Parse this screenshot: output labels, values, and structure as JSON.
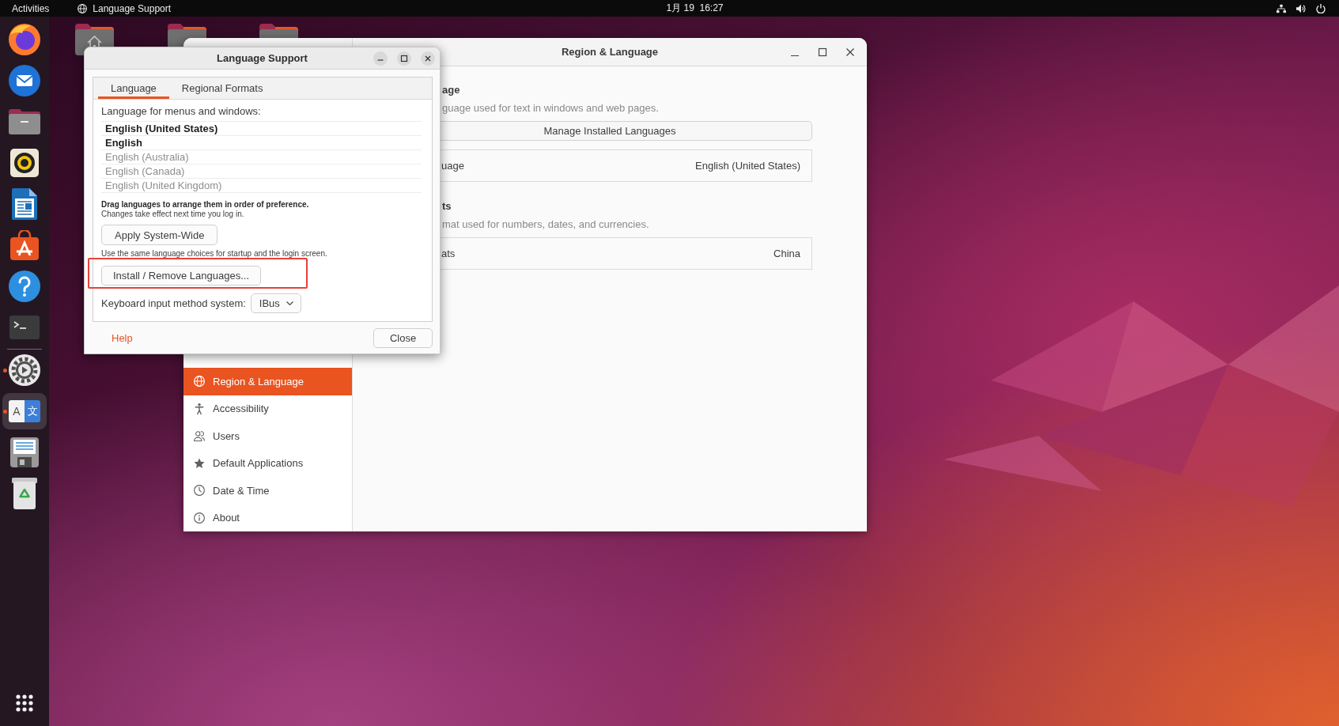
{
  "top_bar": {
    "activities": "Activities",
    "app_menu": "Language Support",
    "clock": "1月 19  16:27"
  },
  "dock": {
    "sections": [
      {
        "items": [
          {
            "kind": "browser",
            "running": false,
            "selected": false
          },
          {
            "kind": "mail",
            "running": false,
            "selected": false
          },
          {
            "kind": "files",
            "running": false,
            "selected": false
          },
          {
            "kind": "music",
            "running": false,
            "selected": false
          },
          {
            "kind": "writer",
            "running": false,
            "selected": false
          },
          {
            "kind": "store",
            "running": false,
            "selected": false
          },
          {
            "kind": "help",
            "running": false,
            "selected": false
          },
          {
            "kind": "terminal",
            "running": false,
            "selected": false
          }
        ]
      },
      {
        "items": [
          {
            "kind": "settings",
            "running": true,
            "selected": false
          },
          {
            "kind": "language",
            "running": true,
            "selected": true,
            "glyphs": [
              "A",
              "文"
            ]
          },
          {
            "kind": "disk",
            "running": false,
            "selected": false
          },
          {
            "kind": "trash",
            "running": false,
            "selected": false
          }
        ]
      }
    ]
  },
  "desktop": {
    "icons": [
      {
        "kind": "home"
      },
      {
        "kind": "folder"
      },
      {
        "kind": "folder"
      }
    ]
  },
  "settings_window": {
    "title": "Region & Language",
    "sidebar": [
      {
        "kind": "globe",
        "label": "Region & Language",
        "selected": true
      },
      {
        "kind": "accessibility",
        "label": "Accessibility",
        "selected": false
      },
      {
        "kind": "users",
        "label": "Users",
        "selected": false
      },
      {
        "kind": "star",
        "label": "Default Applications",
        "selected": false
      },
      {
        "kind": "clock",
        "label": "Date & Time",
        "selected": false
      },
      {
        "kind": "info",
        "label": "About",
        "selected": false
      }
    ],
    "sections": [
      {
        "heading": "age",
        "description": "guage used for text in windows and web pages.",
        "button": "Manage Installed Languages",
        "row": {
          "label": "uage",
          "value": "English (United States)"
        }
      },
      {
        "heading": "ts",
        "description": "mat used for numbers, dates, and currencies.",
        "row": {
          "label": "ats",
          "value": "China"
        }
      }
    ]
  },
  "language_dialog": {
    "title": "Language Support",
    "tabs": [
      {
        "label": "Language",
        "selected": true
      },
      {
        "label": "Regional Formats",
        "selected": false
      }
    ],
    "list_label": "Language for menus and windows:",
    "languages": [
      {
        "name": "English (United States)",
        "disabled": false
      },
      {
        "name": "English",
        "disabled": false
      },
      {
        "name": "English (Australia)",
        "disabled": true
      },
      {
        "name": "English (Canada)",
        "disabled": true
      },
      {
        "name": "English (United Kingdom)",
        "disabled": true
      }
    ],
    "hint": "Drag languages to arrange them in order of preference.",
    "hint_note": "Changes take effect next time you log in.",
    "apply_button": "Apply System-Wide",
    "apply_note": "Use the same language choices for startup and the login screen.",
    "install_button": "Install / Remove Languages...",
    "input_method": {
      "label": "Keyboard input method system:",
      "value": "IBus"
    },
    "help": "Help",
    "close": "Close"
  }
}
